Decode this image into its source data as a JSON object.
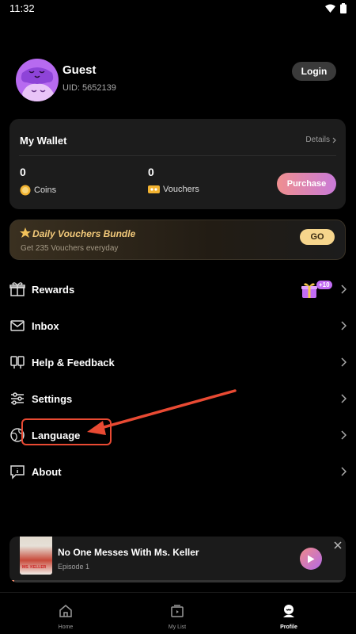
{
  "status_bar": {
    "time": "11:32"
  },
  "profile": {
    "name": "Guest",
    "uid": "UID: 5652139",
    "login_label": "Login"
  },
  "wallet": {
    "title": "My Wallet",
    "details_label": "Details",
    "coins_value": "0",
    "coins_label": "Coins",
    "vouchers_value": "0",
    "vouchers_label": "Vouchers",
    "purchase_label": "Purchase"
  },
  "bundle": {
    "title": "Daily Vouchers Bundle",
    "subtitle": "Get 235 Vouchers everyday",
    "go_label": "GO"
  },
  "menu": {
    "items": [
      {
        "label": "Rewards",
        "icon": "gift-outline-icon",
        "badge": "+10"
      },
      {
        "label": "Inbox",
        "icon": "envelope-icon"
      },
      {
        "label": "Help & Feedback",
        "icon": "help-icon"
      },
      {
        "label": "Settings",
        "icon": "sliders-icon"
      },
      {
        "label": "Language",
        "icon": "globe-icon"
      },
      {
        "label": "About",
        "icon": "info-chat-icon"
      }
    ]
  },
  "mini_player": {
    "title": "No One Messes With Ms. Keller",
    "episode": "Episode 1",
    "poster_text": "MS. KELLER",
    "progress": 0.015
  },
  "tabs": [
    {
      "label": "Home",
      "active": false
    },
    {
      "label": "My List",
      "active": false
    },
    {
      "label": "Profile",
      "active": true
    }
  ],
  "colors": {
    "accent": "#e94a33",
    "purchase_gradient_start": "#ef8f8f",
    "purchase_gradient_end": "#c97ad8",
    "bundle_gold": "#f2c97a"
  }
}
